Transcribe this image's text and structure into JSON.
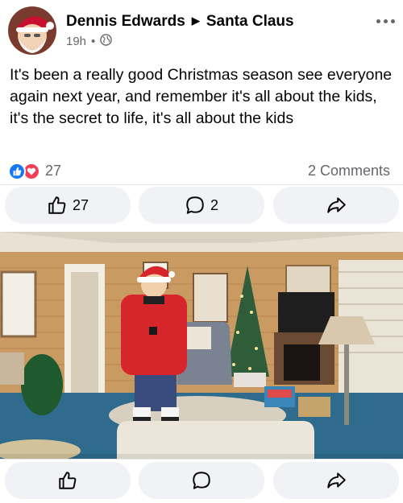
{
  "post": {
    "author": "Dennis Edwards",
    "recipient": "Santa Claus",
    "time": "19h",
    "separator": "•",
    "text": "It's been a really good Christmas season see everyone again next year, and remember it's all about the kids, it's the secret to life, it's all about the kids",
    "privacy_icon": "globe-icon"
  },
  "reactions": {
    "count": "27",
    "icons": [
      "like-icon",
      "love-icon"
    ],
    "comments_label": "2 Comments"
  },
  "actions_top": {
    "like_count": "27",
    "comment_count": "2",
    "share_icon": "share-icon"
  },
  "actions_bottom": {
    "like_icon": "like-icon",
    "comment_icon": "comment-icon",
    "share_icon": "share-icon"
  },
  "colors": {
    "like_blue": "#1877f2",
    "love_red": "#f33e58",
    "secondary_text": "#65676b",
    "button_bg": "#f0f2f5"
  }
}
